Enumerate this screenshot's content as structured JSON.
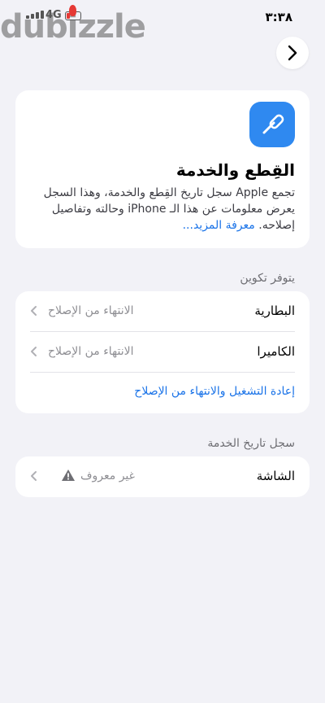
{
  "status_bar": {
    "time": "٣:٣٨",
    "network": "4G"
  },
  "watermark": {
    "text": "dubizzle"
  },
  "colors": {
    "accent": "#1a73e8",
    "icon_bg": "#2f89f0",
    "background": "#f2f2f7"
  },
  "hero": {
    "icon": "screwdriver-icon",
    "title": "القِطع والخدمة",
    "description": "تجمع Apple سجل تاريخ القِطع والخدمة، وهذا السجل يعرض معلومات عن هذا الـ iPhone وحالته وتفاصيل إصلاحه.",
    "link": "معرفة المزيد..."
  },
  "availability": {
    "header": "يتوفر تكوين",
    "rows": [
      {
        "label": "البطارية",
        "value": "الانتهاء من الإصلاح"
      },
      {
        "label": "الكاميرا",
        "value": "الانتهاء من الإصلاح"
      }
    ],
    "action": "إعادة التشغيل والانتهاء من الإصلاح"
  },
  "history": {
    "header": "سجل تاريخ الخدمة",
    "rows": [
      {
        "label": "الشاشة",
        "value": "غير معروف",
        "icon": "warning-icon"
      }
    ]
  }
}
